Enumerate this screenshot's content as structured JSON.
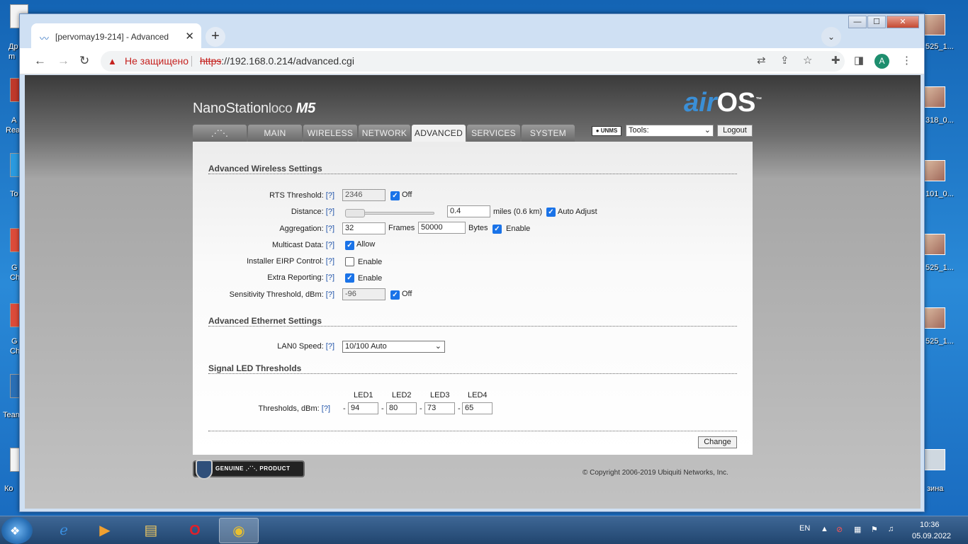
{
  "desktop": {
    "left_labels": [
      "Др",
      "m",
      "A",
      "Rea",
      "To",
      "G",
      "Ch",
      "G",
      "Ch",
      "Team",
      "Ко"
    ],
    "right_labels": [
      "525_1...",
      "318_0...",
      "101_0...",
      "525_1...",
      "525_1...",
      "зина"
    ]
  },
  "window": {
    "min": "—",
    "max": "☐",
    "close": "✕"
  },
  "tab": {
    "title": "[pervomay19-214] - Advanced",
    "close": "✕",
    "newtab": "+"
  },
  "toolbar": {
    "back": "←",
    "forward": "→",
    "reload": "↻",
    "not_secure": "Не защищено",
    "url_scheme": "https",
    "url_rest": "://192.168.0.214/advanced.cgi",
    "avatar": "A"
  },
  "header": {
    "brand": "NanoStation",
    "brand_loco": "loco",
    "brand_m5": "M5",
    "airos_air": "air",
    "airos_os": "OS",
    "airos_tm": "™"
  },
  "nav": {
    "tabs": [
      "MAIN",
      "WIRELESS",
      "NETWORK",
      "ADVANCED",
      "SERVICES",
      "SYSTEM"
    ],
    "active": "ADVANCED",
    "unms": "UNMS",
    "tools": "Tools:",
    "logout": "Logout"
  },
  "wireless": {
    "title": "Advanced Wireless Settings",
    "help": "[?]",
    "rts_label": "RTS Threshold:",
    "rts_value": "2346",
    "rts_off": "Off",
    "distance_label": "Distance:",
    "distance_value": "0.4",
    "distance_unit": "miles (0.6 km)",
    "auto_adjust": "Auto Adjust",
    "aggregation_label": "Aggregation:",
    "agg_frames": "32",
    "frames": "Frames",
    "agg_bytes": "50000",
    "bytes": "Bytes",
    "enable": "Enable",
    "multicast_label": "Multicast Data:",
    "allow": "Allow",
    "eirp_label": "Installer EIRP Control:",
    "extra_label": "Extra Reporting:",
    "sens_label": "Sensitivity Threshold, dBm:",
    "sens_value": "-96",
    "sens_off": "Off"
  },
  "ethernet": {
    "title": "Advanced Ethernet Settings",
    "lan_label": "LAN0 Speed:",
    "lan_value": "10/100 Auto"
  },
  "led": {
    "title": "Signal LED Thresholds",
    "headers": [
      "LED1",
      "LED2",
      "LED3",
      "LED4"
    ],
    "label": "Thresholds, dBm:",
    "values": [
      "94",
      "80",
      "73",
      "65"
    ],
    "dash": "-"
  },
  "footer": {
    "change": "Change",
    "genuine": "GENUINE ⋰⋱ PRODUCT",
    "copyright": "© Copyright 2006-2019 Ubiquiti Networks, Inc."
  },
  "taskbar": {
    "lang": "EN",
    "time": "10:36",
    "date": "05.09.2022"
  },
  "colors": {
    "accent": "#1a73e8",
    "warning": "#c5221f",
    "airos_blue": "#3b8fd6"
  }
}
